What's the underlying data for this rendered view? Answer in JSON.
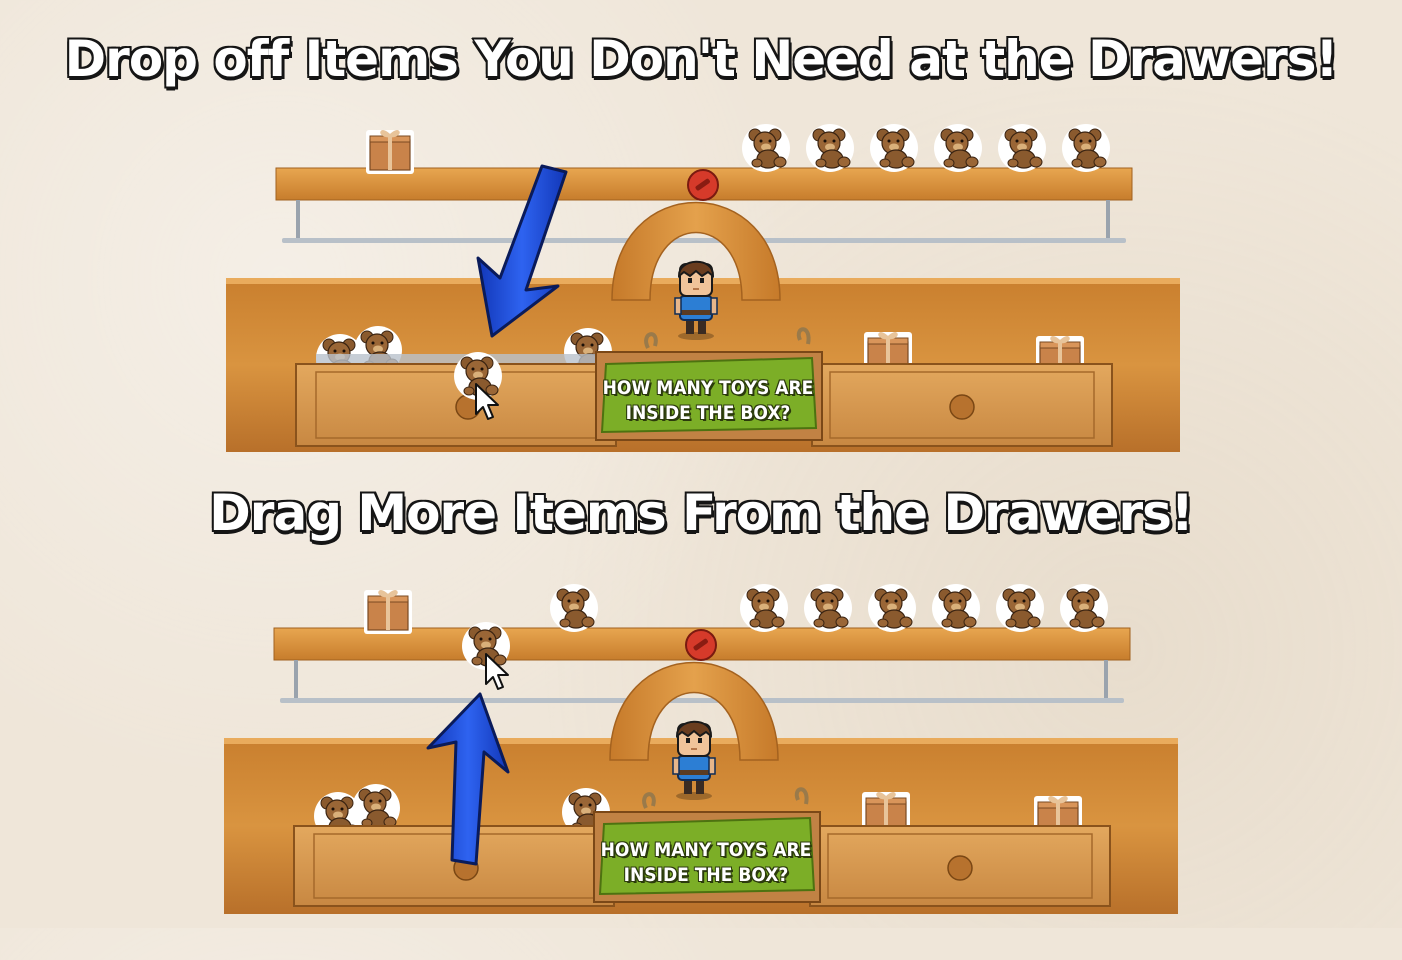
{
  "titles": {
    "drop_off": "Drop off Items You Don't Need at the Drawers!",
    "drag_more": "Drag More Items From the Drawers!"
  },
  "panels": [
    {
      "sign": {
        "line1": "HOW MANY TOYS ARE",
        "line2": "INSIDE THE BOX?"
      },
      "arrow_direction": "down",
      "shelf_items": [
        "gift-box",
        "teddy-bear",
        "teddy-bear",
        "teddy-bear",
        "teddy-bear",
        "teddy-bear",
        "teddy-bear"
      ],
      "dragged_item": "teddy-bear"
    },
    {
      "sign": {
        "line1": "HOW MANY TOYS ARE",
        "line2": "INSIDE THE BOX?"
      },
      "arrow_direction": "up",
      "shelf_items": [
        "gift-box",
        "teddy-bear",
        "teddy-bear",
        "teddy-bear",
        "teddy-bear",
        "teddy-bear",
        "teddy-bear",
        "teddy-bear"
      ],
      "dragged_item": "teddy-bear"
    }
  ],
  "colors": {
    "wood": "#d08a34",
    "arrow": "#1f4fe0",
    "sign_green": "#7cae27",
    "knob": "#d63a2a"
  }
}
